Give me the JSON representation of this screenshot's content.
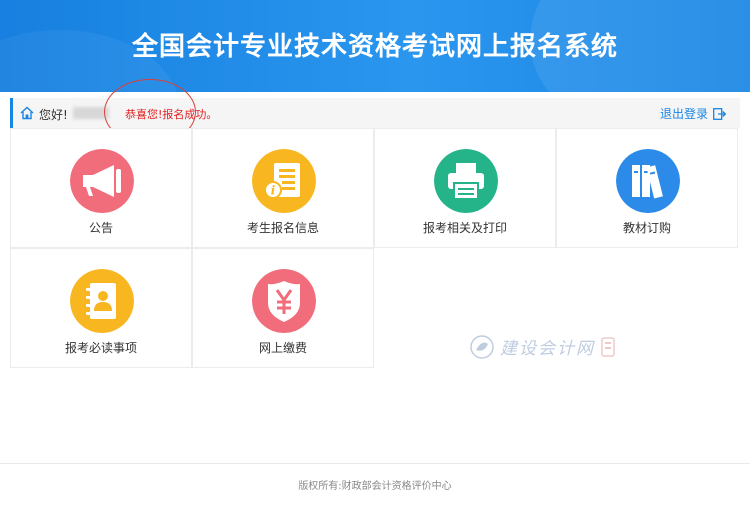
{
  "header": {
    "title": "全国会计专业技术资格考试网上报名系统"
  },
  "welcome": {
    "greeting": "您好!",
    "success_message": "恭喜您!报名成功。",
    "logout_label": "退出登录"
  },
  "tiles": [
    {
      "label": "公告",
      "icon": "megaphone-icon",
      "color": "#f26d7b"
    },
    {
      "label": "考生报名信息",
      "icon": "info-document-icon",
      "color": "#f8b620"
    },
    {
      "label": "报考相关及打印",
      "icon": "printer-icon",
      "color": "#25b48a"
    },
    {
      "label": "教材订购",
      "icon": "books-icon",
      "color": "#2c8be8"
    },
    {
      "label": "报考必读事项",
      "icon": "contact-book-icon",
      "color": "#f8b620"
    },
    {
      "label": "网上缴费",
      "icon": "yuan-shield-icon",
      "color": "#f26d7b"
    }
  ],
  "watermark": {
    "text": "建设会计网"
  },
  "footer": {
    "text": "版权所有:财政部会计资格评价中心"
  }
}
